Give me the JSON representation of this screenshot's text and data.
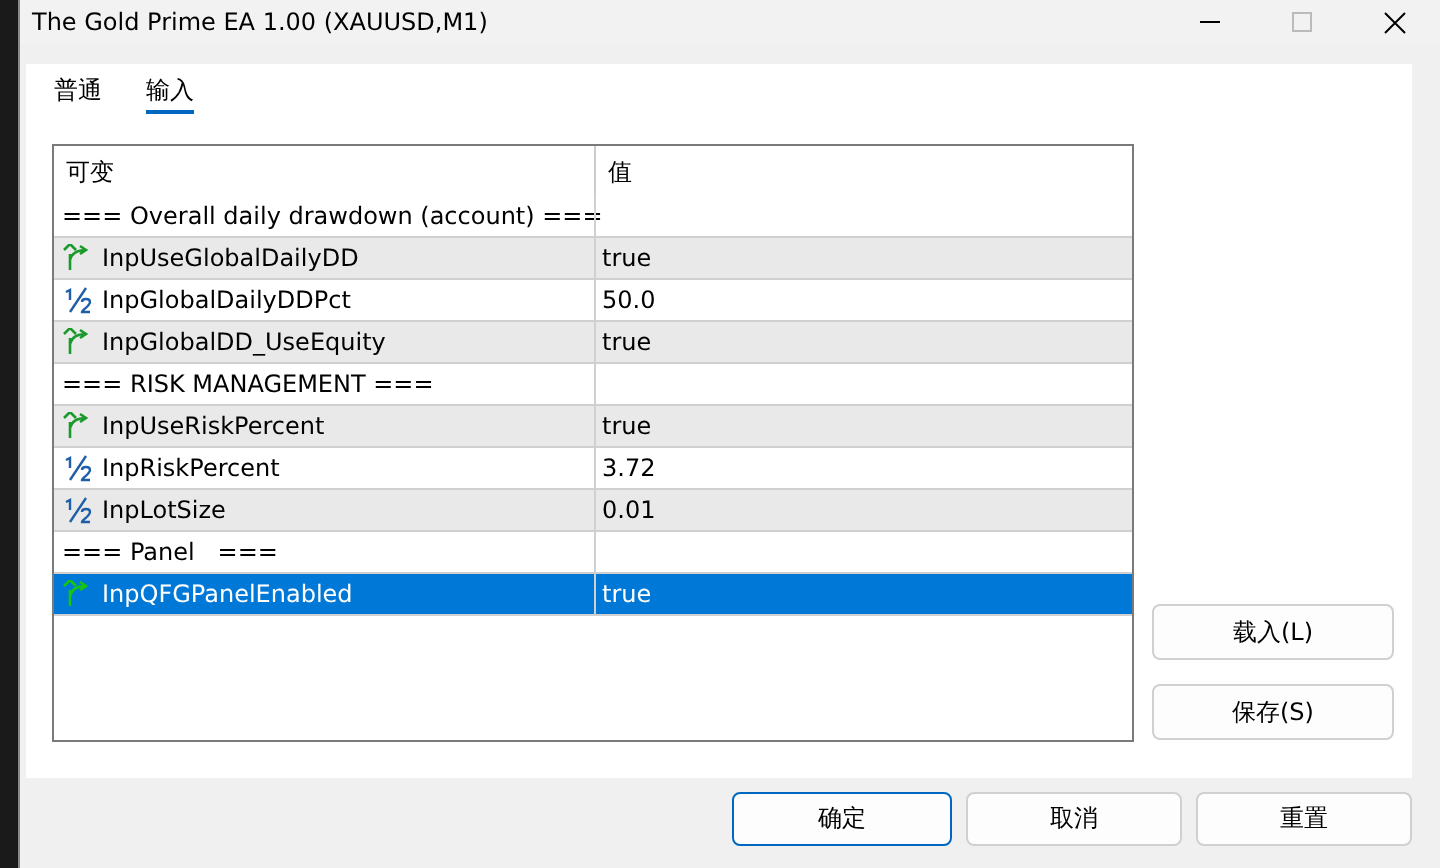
{
  "window": {
    "title": "The Gold Prime EA 1.00 (XAUUSD,M1)"
  },
  "tabs": [
    {
      "label": "普通",
      "selected": false
    },
    {
      "label": "输入",
      "selected": true
    }
  ],
  "table": {
    "columns": [
      "可变",
      "值"
    ],
    "rows": [
      {
        "kind": "section",
        "name": "=== Overall daily drawdown (account) ===",
        "selected": false
      },
      {
        "kind": "bool",
        "name": "InpUseGlobalDailyDD",
        "value": "true",
        "selected": false
      },
      {
        "kind": "number",
        "name": "InpGlobalDailyDDPct",
        "value": "50.0",
        "selected": false
      },
      {
        "kind": "bool",
        "name": "InpGlobalDD_UseEquity",
        "value": "true",
        "selected": false
      },
      {
        "kind": "section",
        "name": "=== RISK MANAGEMENT ===",
        "selected": false
      },
      {
        "kind": "bool",
        "name": "InpUseRiskPercent",
        "value": "true",
        "selected": false
      },
      {
        "kind": "number",
        "name": "InpRiskPercent",
        "value": "3.72",
        "selected": false
      },
      {
        "kind": "number",
        "name": "InpLotSize",
        "value": "0.01",
        "selected": false
      },
      {
        "kind": "section",
        "name": "=== Panel   ===",
        "selected": false
      },
      {
        "kind": "bool",
        "name": "InpQFGPanelEnabled",
        "value": "true",
        "selected": true
      }
    ]
  },
  "side_buttons": [
    "载入(L)",
    "保存(S)"
  ],
  "buttons": [
    {
      "label": "确定",
      "default": true
    },
    {
      "label": "取消",
      "default": false
    },
    {
      "label": "重置",
      "default": false
    }
  ]
}
